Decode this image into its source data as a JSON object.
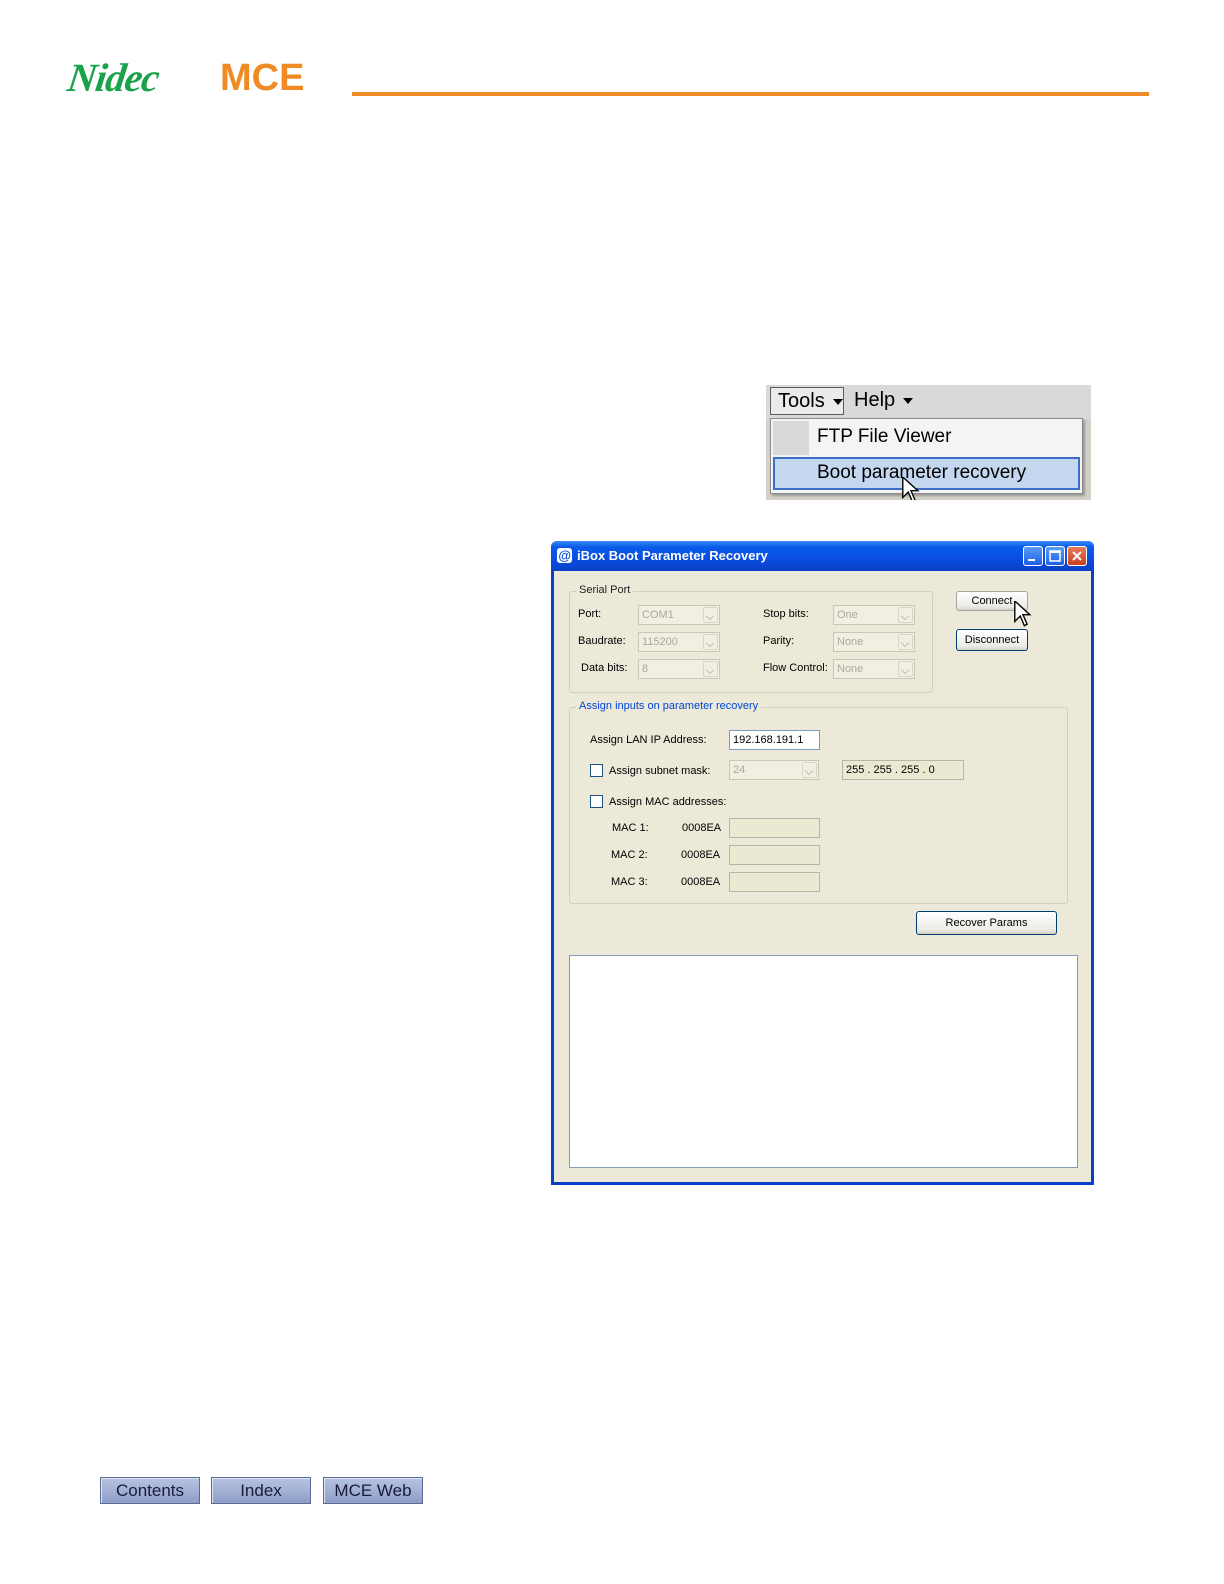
{
  "header": {
    "logo_nidec": "Nidec",
    "logo_mce": "MCE",
    "brand_green": "#1aa24a",
    "brand_orange": "#f08a24"
  },
  "menu_screenshot": {
    "menus": [
      "Tools",
      "Help"
    ],
    "items": [
      "FTP File Viewer",
      "Boot parameter recovery"
    ],
    "highlighted_item": "Boot parameter recovery"
  },
  "dialog": {
    "title": "iBox Boot Parameter Recovery",
    "serial_port": {
      "group_label": "Serial Port",
      "port_label": "Port:",
      "port_value": "COM1",
      "baudrate_label": "Baudrate:",
      "baudrate_value": "115200",
      "databits_label": "Data bits:",
      "databits_value": "8",
      "stopbits_label": "Stop bits:",
      "stopbits_value": "One",
      "parity_label": "Parity:",
      "parity_value": "None",
      "flow_label": "Flow Control:",
      "flow_value": "None"
    },
    "connect_label": "Connect",
    "disconnect_label": "Disconnect",
    "assign": {
      "group_label": "Assign inputs on parameter recovery",
      "lan_ip_label": "Assign LAN IP Address:",
      "lan_ip_value": "192.168.191.1",
      "subnet_label": "Assign subnet mask:",
      "subnet_combo_value": "24",
      "subnet_value": "255 . 255 . 255 . 0",
      "mac_label": "Assign MAC addresses:",
      "mac1_label": "MAC 1:",
      "mac2_label": "MAC 2:",
      "mac3_label": "MAC 3:",
      "mac_prefix": "0008EA"
    },
    "recover_label": "Recover Params"
  },
  "footer": {
    "contents_label": "Contents",
    "index_label": "Index",
    "web_label": "MCE Web"
  }
}
